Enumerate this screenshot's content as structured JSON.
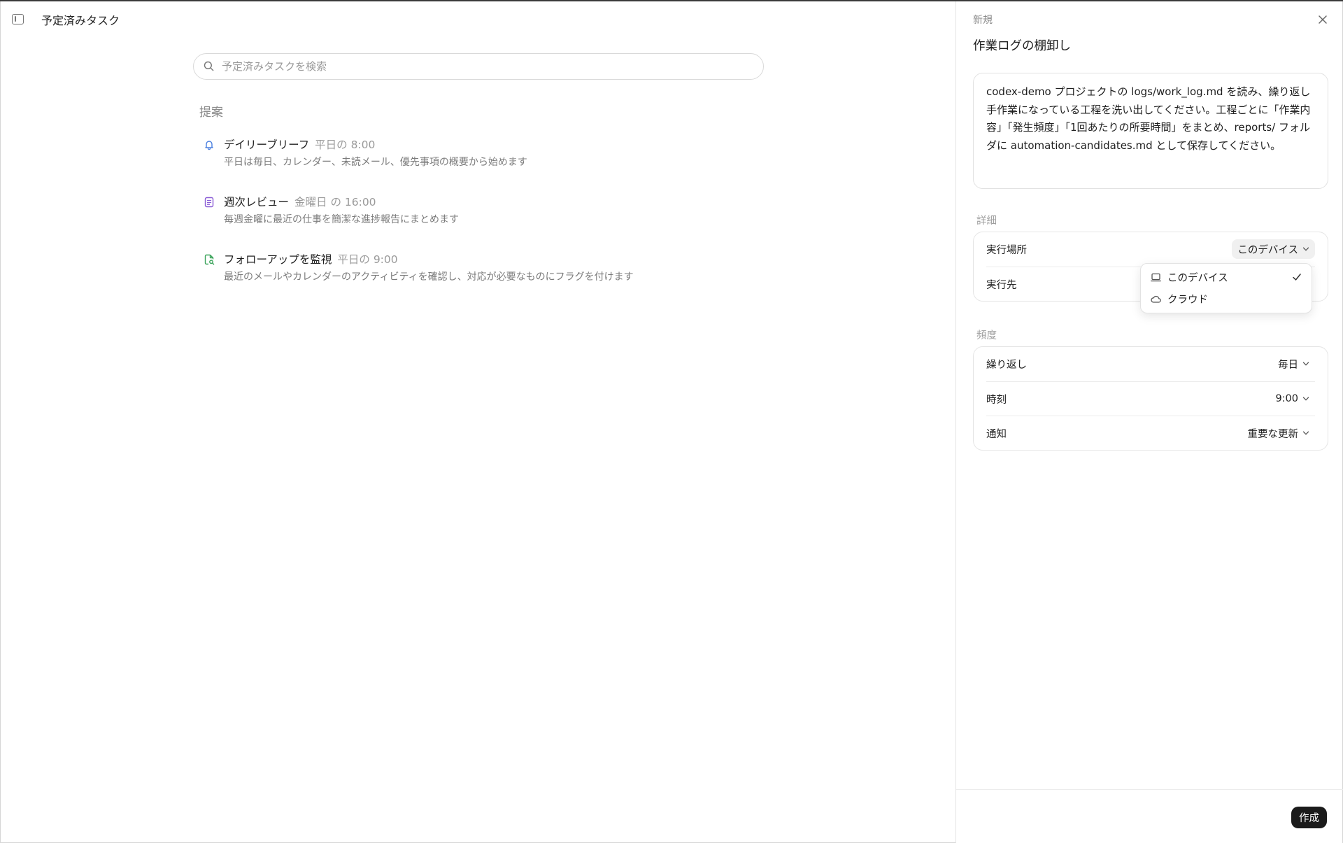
{
  "header": {
    "title": "予定済みタスク"
  },
  "search": {
    "placeholder": "予定済みタスクを検索"
  },
  "suggestions": {
    "label": "提案",
    "items": [
      {
        "title": "デイリーブリーフ",
        "schedule": "平日の 8:00",
        "description": "平日は毎日、カレンダー、未読メール、優先事項の概要から始めます",
        "icon": "bell-icon",
        "color": "#4a7fe0"
      },
      {
        "title": "週次レビュー",
        "schedule": "金曜日 の 16:00",
        "description": "毎週金曜に最近の仕事を簡潔な進捗報告にまとめます",
        "icon": "document-icon",
        "color": "#8a5cd6"
      },
      {
        "title": "フォローアップを監視",
        "schedule": "平日の 9:00",
        "description": "最近のメールやカレンダーのアクティビティを確認し、対応が必要なものにフラグを付けます",
        "icon": "file-search-icon",
        "color": "#3aa35a"
      }
    ]
  },
  "panel": {
    "new_label": "新規",
    "task_title": "作業ログの棚卸し",
    "prompt": "codex-demo プロジェクトの logs/work_log.md を読み、繰り返し手作業になっている工程を洗い出してください。工程ごとに「作業内容」「発生頻度」「1回あたりの所要時間」をまとめ、reports/ フォルダに automation-candidates.md として保存してください。",
    "details": {
      "label": "詳細",
      "location_label": "実行場所",
      "location_value": "このデバイス",
      "target_label": "実行先"
    },
    "dropdown": {
      "options": [
        {
          "label": "このデバイス",
          "icon": "laptop-icon",
          "selected": true
        },
        {
          "label": "クラウド",
          "icon": "cloud-icon",
          "selected": false
        }
      ]
    },
    "frequency": {
      "label": "頻度",
      "repeat_label": "繰り返し",
      "repeat_value": "毎日",
      "time_label": "時刻",
      "time_value": "9:00",
      "notify_label": "通知",
      "notify_value": "重要な更新"
    },
    "create_label": "作成"
  }
}
